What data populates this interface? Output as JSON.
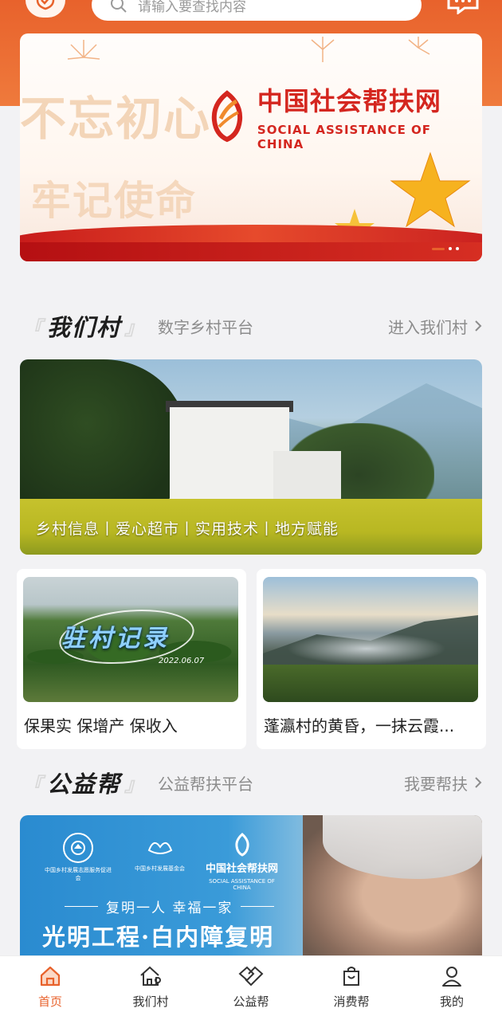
{
  "header": {
    "search_placeholder": "请输入要查找内容",
    "logo_icon": "brand-shield-icon",
    "message_icon": "message-icon"
  },
  "banner": {
    "motto_line1": "不忘初心",
    "motto_line2": "牢记使命",
    "brand_title": "中国社会帮扶网",
    "brand_subtitle": "SOCIAL ASSISTANCE OF CHINA",
    "slide_count": 3,
    "active_slide": 1
  },
  "section_village": {
    "title": "我们村",
    "subtitle": "数字乡村平台",
    "more_label": "进入我们村",
    "feature_caption": "乡村信息丨爱心超市丨实用技术丨地方赋能",
    "stories": [
      {
        "title": "保果实 保增产 保收入",
        "image_text": "驻村记录",
        "image_date": "2022.06.07"
      },
      {
        "title": "蓬瀛村的黄昏，一抹云霞..."
      }
    ]
  },
  "section_charity": {
    "title": "公益帮",
    "subtitle": "公益帮扶平台",
    "more_label": "我要帮扶",
    "banner": {
      "org1_caption": "中国乡村发展志愿服务促进会",
      "org2_caption": "中国乡村发展基金会",
      "org3_name": "中国社会帮扶网",
      "org3_sub": "SOCIAL ASSISTANCE OF CHINA",
      "slogan": "复明一人 幸福一家",
      "title": "光明工程·白内障复明"
    }
  },
  "tabbar": {
    "items": [
      {
        "label": "首页",
        "icon": "home-icon",
        "active": true
      },
      {
        "label": "我们村",
        "icon": "village-icon",
        "active": false
      },
      {
        "label": "公益帮",
        "icon": "charity-icon",
        "active": false
      },
      {
        "label": "消费帮",
        "icon": "shopping-bag-icon",
        "active": false
      },
      {
        "label": "我的",
        "icon": "profile-icon",
        "active": false
      }
    ]
  },
  "colors": {
    "accent": "#e8622c",
    "brand_red": "#d4261f"
  }
}
